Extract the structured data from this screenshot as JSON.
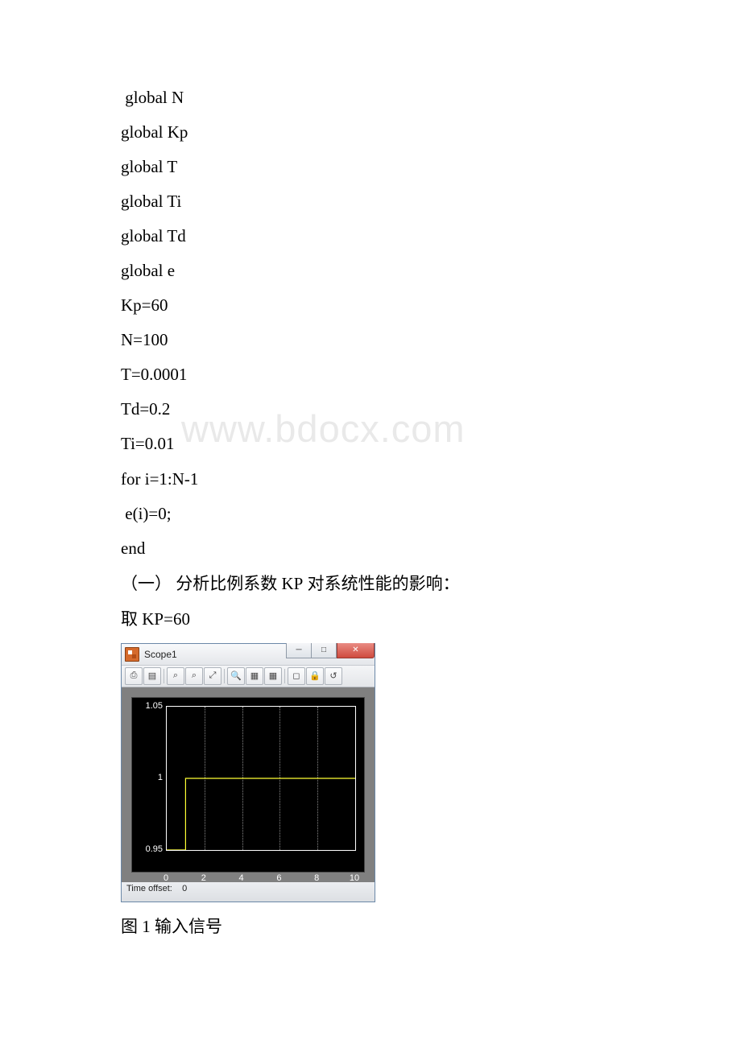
{
  "code_lines": [
    " global N",
    "global Kp",
    "global T",
    "global Ti",
    "global Td",
    "global e",
    "Kp=60",
    "N=100",
    "T=0.0001",
    "Td=0.2",
    "Ti=0.01",
    "for i=1:N-1",
    " e(i)=0;",
    "end"
  ],
  "section_line_prefix": "（一） 分析比例系数 ",
  "section_line_kp": "KP",
  "section_line_suffix": " 对系统性能的影响：",
  "take_prefix": "取 ",
  "take_value": "KP=60",
  "watermark": "www.bdocx.com",
  "scope": {
    "title": "Scope1",
    "status_label": "Time offset:",
    "status_value": "0",
    "toolbar_icons": [
      "print-icon",
      "params-icon",
      "zoom-in-icon",
      "zoom-out-icon",
      "zoom-reset-icon",
      "find-icon",
      "data-linking-icon",
      "cursor-icon",
      "float-icon",
      "lock-icon",
      "restore-icon"
    ]
  },
  "caption_prefix": "图 ",
  "caption_num": "1",
  "caption_text": " 输入信号",
  "chart_data": {
    "type": "line",
    "title": "",
    "xlabel": "",
    "ylabel": "",
    "xlim": [
      0,
      10
    ],
    "ylim": [
      0.95,
      1.05
    ],
    "xticks": [
      0,
      2,
      4,
      6,
      8,
      10
    ],
    "yticks": [
      0.95,
      1,
      1.05
    ],
    "grid_vertical": true,
    "grid_horizontal": false,
    "series": [
      {
        "name": "step",
        "color": "#ffff33",
        "x": [
          0,
          1,
          1,
          10
        ],
        "y": [
          0.95,
          0.95,
          1.0,
          1.0
        ]
      }
    ]
  }
}
